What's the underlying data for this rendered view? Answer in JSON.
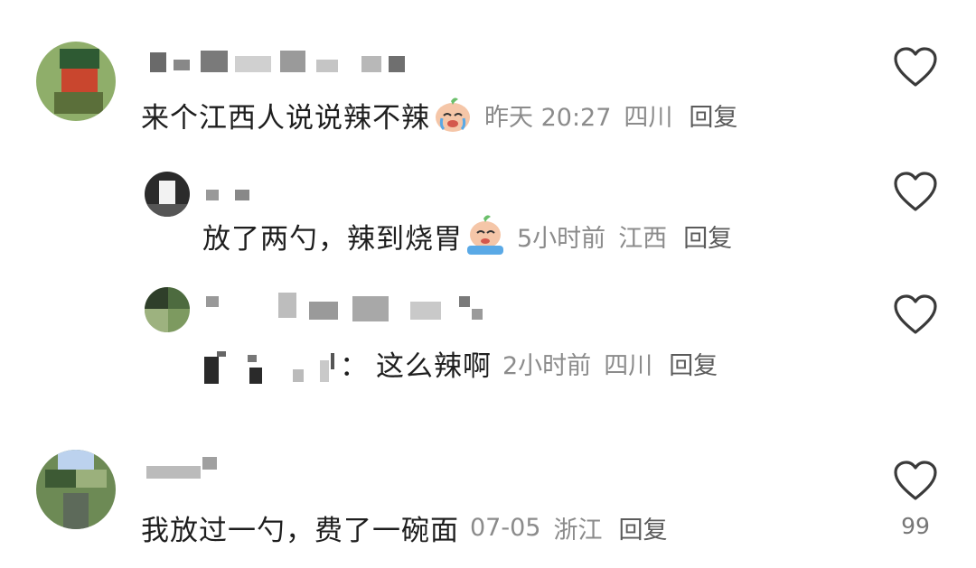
{
  "comments": [
    {
      "text": "来个江西人说说辣不辣",
      "emoji": "crying-face-emoji",
      "time": "昨天 20:27",
      "location": "四川",
      "reply_label": "回复",
      "replies": [
        {
          "text": "放了两勺，辣到烧胃",
          "emoji": "crying-face-emoji",
          "time": "5小时前",
          "location": "江西",
          "reply_label": "回复"
        },
        {
          "reply_to_separator": "：",
          "text": "这么辣啊",
          "time": "2小时前",
          "location": "四川",
          "reply_label": "回复"
        }
      ]
    },
    {
      "text": "我放过一勺，费了一碗面",
      "time": "07-05",
      "location": "浙江",
      "reply_label": "回复",
      "like_count": "99"
    }
  ],
  "icons": {
    "like": "heart-outline-icon"
  },
  "colors": {
    "text": "#1e1e1e",
    "meta": "#8b8b8b",
    "icon": "#3a3a3a"
  }
}
